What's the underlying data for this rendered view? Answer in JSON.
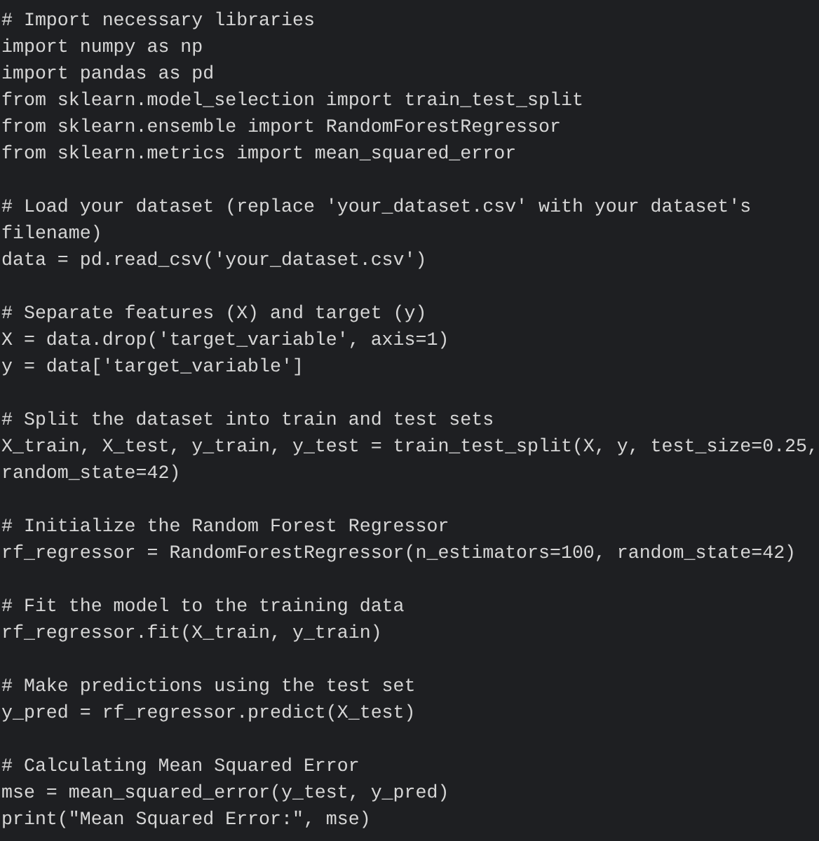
{
  "code_blocks": [
    {
      "lines": [
        "# Import necessary libraries",
        "import numpy as np",
        "import pandas as pd",
        "from sklearn.model_selection import train_test_split",
        "from sklearn.ensemble import RandomForestRegressor",
        "from sklearn.metrics import mean_squared_error"
      ]
    },
    {
      "lines": [
        "# Load your dataset (replace 'your_dataset.csv' with your dataset's",
        "filename)",
        "data = pd.read_csv('your_dataset.csv')"
      ]
    },
    {
      "lines": [
        "# Separate features (X) and target (y)",
        "X = data.drop('target_variable', axis=1)",
        "y = data['target_variable']"
      ]
    },
    {
      "lines": [
        "# Split the dataset into train and test sets",
        "X_train, X_test, y_train, y_test = train_test_split(X, y, test_size=0.25,",
        "random_state=42)"
      ]
    },
    {
      "lines": [
        "# Initialize the Random Forest Regressor",
        "rf_regressor = RandomForestRegressor(n_estimators=100, random_state=42)"
      ]
    },
    {
      "lines": [
        "# Fit the model to the training data",
        "rf_regressor.fit(X_train, y_train)"
      ]
    },
    {
      "lines": [
        "# Make predictions using the test set",
        "y_pred = rf_regressor.predict(X_test)"
      ]
    },
    {
      "lines": [
        "# Calculating Mean Squared Error",
        "mse = mean_squared_error(y_test, y_pred)",
        "print(\"Mean Squared Error:\", mse)"
      ]
    }
  ]
}
